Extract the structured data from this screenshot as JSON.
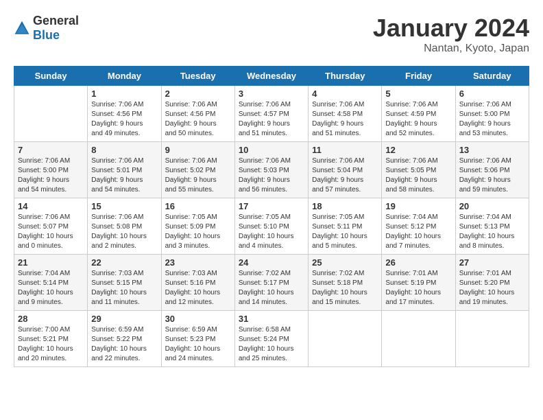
{
  "header": {
    "logo": {
      "general": "General",
      "blue": "Blue"
    },
    "title": "January 2024",
    "location": "Nantan, Kyoto, Japan"
  },
  "calendar": {
    "days_of_week": [
      "Sunday",
      "Monday",
      "Tuesday",
      "Wednesday",
      "Thursday",
      "Friday",
      "Saturday"
    ],
    "weeks": [
      [
        {
          "day": "",
          "info": ""
        },
        {
          "day": "1",
          "info": "Sunrise: 7:06 AM\nSunset: 4:56 PM\nDaylight: 9 hours\nand 49 minutes."
        },
        {
          "day": "2",
          "info": "Sunrise: 7:06 AM\nSunset: 4:56 PM\nDaylight: 9 hours\nand 50 minutes."
        },
        {
          "day": "3",
          "info": "Sunrise: 7:06 AM\nSunset: 4:57 PM\nDaylight: 9 hours\nand 51 minutes."
        },
        {
          "day": "4",
          "info": "Sunrise: 7:06 AM\nSunset: 4:58 PM\nDaylight: 9 hours\nand 51 minutes."
        },
        {
          "day": "5",
          "info": "Sunrise: 7:06 AM\nSunset: 4:59 PM\nDaylight: 9 hours\nand 52 minutes."
        },
        {
          "day": "6",
          "info": "Sunrise: 7:06 AM\nSunset: 5:00 PM\nDaylight: 9 hours\nand 53 minutes."
        }
      ],
      [
        {
          "day": "7",
          "info": "Sunrise: 7:06 AM\nSunset: 5:00 PM\nDaylight: 9 hours\nand 54 minutes."
        },
        {
          "day": "8",
          "info": "Sunrise: 7:06 AM\nSunset: 5:01 PM\nDaylight: 9 hours\nand 54 minutes."
        },
        {
          "day": "9",
          "info": "Sunrise: 7:06 AM\nSunset: 5:02 PM\nDaylight: 9 hours\nand 55 minutes."
        },
        {
          "day": "10",
          "info": "Sunrise: 7:06 AM\nSunset: 5:03 PM\nDaylight: 9 hours\nand 56 minutes."
        },
        {
          "day": "11",
          "info": "Sunrise: 7:06 AM\nSunset: 5:04 PM\nDaylight: 9 hours\nand 57 minutes."
        },
        {
          "day": "12",
          "info": "Sunrise: 7:06 AM\nSunset: 5:05 PM\nDaylight: 9 hours\nand 58 minutes."
        },
        {
          "day": "13",
          "info": "Sunrise: 7:06 AM\nSunset: 5:06 PM\nDaylight: 9 hours\nand 59 minutes."
        }
      ],
      [
        {
          "day": "14",
          "info": "Sunrise: 7:06 AM\nSunset: 5:07 PM\nDaylight: 10 hours\nand 0 minutes."
        },
        {
          "day": "15",
          "info": "Sunrise: 7:06 AM\nSunset: 5:08 PM\nDaylight: 10 hours\nand 2 minutes."
        },
        {
          "day": "16",
          "info": "Sunrise: 7:05 AM\nSunset: 5:09 PM\nDaylight: 10 hours\nand 3 minutes."
        },
        {
          "day": "17",
          "info": "Sunrise: 7:05 AM\nSunset: 5:10 PM\nDaylight: 10 hours\nand 4 minutes."
        },
        {
          "day": "18",
          "info": "Sunrise: 7:05 AM\nSunset: 5:11 PM\nDaylight: 10 hours\nand 5 minutes."
        },
        {
          "day": "19",
          "info": "Sunrise: 7:04 AM\nSunset: 5:12 PM\nDaylight: 10 hours\nand 7 minutes."
        },
        {
          "day": "20",
          "info": "Sunrise: 7:04 AM\nSunset: 5:13 PM\nDaylight: 10 hours\nand 8 minutes."
        }
      ],
      [
        {
          "day": "21",
          "info": "Sunrise: 7:04 AM\nSunset: 5:14 PM\nDaylight: 10 hours\nand 9 minutes."
        },
        {
          "day": "22",
          "info": "Sunrise: 7:03 AM\nSunset: 5:15 PM\nDaylight: 10 hours\nand 11 minutes."
        },
        {
          "day": "23",
          "info": "Sunrise: 7:03 AM\nSunset: 5:16 PM\nDaylight: 10 hours\nand 12 minutes."
        },
        {
          "day": "24",
          "info": "Sunrise: 7:02 AM\nSunset: 5:17 PM\nDaylight: 10 hours\nand 14 minutes."
        },
        {
          "day": "25",
          "info": "Sunrise: 7:02 AM\nSunset: 5:18 PM\nDaylight: 10 hours\nand 15 minutes."
        },
        {
          "day": "26",
          "info": "Sunrise: 7:01 AM\nSunset: 5:19 PM\nDaylight: 10 hours\nand 17 minutes."
        },
        {
          "day": "27",
          "info": "Sunrise: 7:01 AM\nSunset: 5:20 PM\nDaylight: 10 hours\nand 19 minutes."
        }
      ],
      [
        {
          "day": "28",
          "info": "Sunrise: 7:00 AM\nSunset: 5:21 PM\nDaylight: 10 hours\nand 20 minutes."
        },
        {
          "day": "29",
          "info": "Sunrise: 6:59 AM\nSunset: 5:22 PM\nDaylight: 10 hours\nand 22 minutes."
        },
        {
          "day": "30",
          "info": "Sunrise: 6:59 AM\nSunset: 5:23 PM\nDaylight: 10 hours\nand 24 minutes."
        },
        {
          "day": "31",
          "info": "Sunrise: 6:58 AM\nSunset: 5:24 PM\nDaylight: 10 hours\nand 25 minutes."
        },
        {
          "day": "",
          "info": ""
        },
        {
          "day": "",
          "info": ""
        },
        {
          "day": "",
          "info": ""
        }
      ]
    ]
  }
}
